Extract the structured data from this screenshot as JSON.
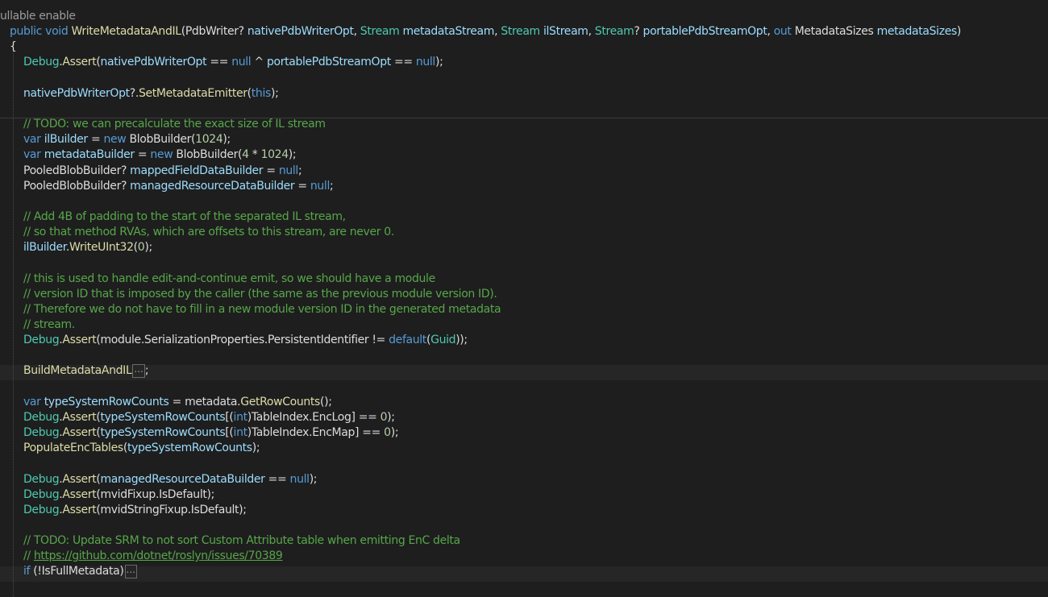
{
  "editor": {
    "lines": [
      {
        "indent": 0,
        "tokens": [
          {
            "t": "ullable enable",
            "c": "directive"
          }
        ]
      },
      {
        "indent": 1,
        "tokens": [
          {
            "t": "public",
            "c": "kw"
          },
          {
            "t": " ",
            "c": "pl"
          },
          {
            "t": "void",
            "c": "kw"
          },
          {
            "t": " ",
            "c": "pl"
          },
          {
            "t": "WriteMetadataAndIL",
            "c": "fn"
          },
          {
            "t": "(",
            "c": "pl"
          },
          {
            "t": "PdbWriter",
            "c": "pl"
          },
          {
            "t": "? ",
            "c": "pl"
          },
          {
            "t": "nativePdbWriterOpt",
            "c": "pm"
          },
          {
            "t": ", ",
            "c": "pl"
          },
          {
            "t": "Stream",
            "c": "tp"
          },
          {
            "t": " ",
            "c": "pl"
          },
          {
            "t": "metadataStream",
            "c": "pm"
          },
          {
            "t": ", ",
            "c": "pl"
          },
          {
            "t": "Stream",
            "c": "tp"
          },
          {
            "t": " ",
            "c": "pl"
          },
          {
            "t": "ilStream",
            "c": "pm"
          },
          {
            "t": ", ",
            "c": "pl"
          },
          {
            "t": "Stream",
            "c": "tp"
          },
          {
            "t": "? ",
            "c": "pl"
          },
          {
            "t": "portablePdbStreamOpt",
            "c": "pm"
          },
          {
            "t": ", ",
            "c": "pl"
          },
          {
            "t": "out",
            "c": "kw"
          },
          {
            "t": " ",
            "c": "pl"
          },
          {
            "t": "MetadataSizes",
            "c": "pl"
          },
          {
            "t": " ",
            "c": "pl"
          },
          {
            "t": "metadataSizes",
            "c": "pm"
          },
          {
            "t": ")",
            "c": "pl"
          }
        ]
      },
      {
        "indent": 1,
        "tokens": [
          {
            "t": "{",
            "c": "pl"
          }
        ]
      },
      {
        "indent": 2,
        "tokens": [
          {
            "t": "Debug",
            "c": "tp"
          },
          {
            "t": ".",
            "c": "pl"
          },
          {
            "t": "Assert",
            "c": "fn"
          },
          {
            "t": "(",
            "c": "pl"
          },
          {
            "t": "nativePdbWriterOpt",
            "c": "pm"
          },
          {
            "t": " == ",
            "c": "pl"
          },
          {
            "t": "null",
            "c": "kw"
          },
          {
            "t": " ^ ",
            "c": "pl"
          },
          {
            "t": "portablePdbStreamOpt",
            "c": "pm"
          },
          {
            "t": " == ",
            "c": "pl"
          },
          {
            "t": "null",
            "c": "kw"
          },
          {
            "t": ");",
            "c": "pl"
          }
        ]
      },
      {
        "indent": 2,
        "tokens": []
      },
      {
        "indent": 2,
        "tokens": [
          {
            "t": "nativePdbWriterOpt",
            "c": "pm"
          },
          {
            "t": "?.",
            "c": "pl"
          },
          {
            "t": "SetMetadataEmitter",
            "c": "fn"
          },
          {
            "t": "(",
            "c": "pl"
          },
          {
            "t": "this",
            "c": "kw"
          },
          {
            "t": ");",
            "c": "pl"
          }
        ]
      },
      {
        "indent": 2,
        "tokens": []
      },
      {
        "indent": 2,
        "tokens": [
          {
            "t": "// TODO: we can precalculate the exact size of IL stream",
            "c": "cm"
          }
        ]
      },
      {
        "indent": 2,
        "tokens": [
          {
            "t": "var",
            "c": "kw"
          },
          {
            "t": " ",
            "c": "pl"
          },
          {
            "t": "ilBuilder",
            "c": "lc"
          },
          {
            "t": " = ",
            "c": "pl"
          },
          {
            "t": "new",
            "c": "kw"
          },
          {
            "t": " ",
            "c": "pl"
          },
          {
            "t": "BlobBuilder",
            "c": "pl"
          },
          {
            "t": "(",
            "c": "pl"
          },
          {
            "t": "1024",
            "c": "nm"
          },
          {
            "t": ");",
            "c": "pl"
          }
        ]
      },
      {
        "indent": 2,
        "tokens": [
          {
            "t": "var",
            "c": "kw"
          },
          {
            "t": " ",
            "c": "pl"
          },
          {
            "t": "metadataBuilder",
            "c": "lc"
          },
          {
            "t": " = ",
            "c": "pl"
          },
          {
            "t": "new",
            "c": "kw"
          },
          {
            "t": " ",
            "c": "pl"
          },
          {
            "t": "BlobBuilder",
            "c": "pl"
          },
          {
            "t": "(",
            "c": "pl"
          },
          {
            "t": "4",
            "c": "nm"
          },
          {
            "t": " * ",
            "c": "pl"
          },
          {
            "t": "1024",
            "c": "nm"
          },
          {
            "t": ");",
            "c": "pl"
          }
        ]
      },
      {
        "indent": 2,
        "tokens": [
          {
            "t": "PooledBlobBuilder",
            "c": "pl"
          },
          {
            "t": "? ",
            "c": "pl"
          },
          {
            "t": "mappedFieldDataBuilder",
            "c": "lc"
          },
          {
            "t": " = ",
            "c": "pl"
          },
          {
            "t": "null",
            "c": "kw"
          },
          {
            "t": ";",
            "c": "pl"
          }
        ]
      },
      {
        "indent": 2,
        "tokens": [
          {
            "t": "PooledBlobBuilder",
            "c": "pl"
          },
          {
            "t": "? ",
            "c": "pl"
          },
          {
            "t": "managedResourceDataBuilder",
            "c": "lc"
          },
          {
            "t": " = ",
            "c": "pl"
          },
          {
            "t": "null",
            "c": "kw"
          },
          {
            "t": ";",
            "c": "pl"
          }
        ]
      },
      {
        "indent": 2,
        "tokens": []
      },
      {
        "indent": 2,
        "tokens": [
          {
            "t": "// Add 4B of padding to the start of the separated IL stream,",
            "c": "cm"
          }
        ]
      },
      {
        "indent": 2,
        "tokens": [
          {
            "t": "// so that method RVAs, which are offsets to this stream, are never 0.",
            "c": "cm"
          }
        ]
      },
      {
        "indent": 2,
        "tokens": [
          {
            "t": "ilBuilder",
            "c": "lc"
          },
          {
            "t": ".",
            "c": "pl"
          },
          {
            "t": "WriteUInt32",
            "c": "fn"
          },
          {
            "t": "(",
            "c": "pl"
          },
          {
            "t": "0",
            "c": "nm"
          },
          {
            "t": ");",
            "c": "pl"
          }
        ]
      },
      {
        "indent": 2,
        "tokens": []
      },
      {
        "indent": 2,
        "tokens": [
          {
            "t": "// this is used to handle edit-and-continue emit, so we should have a module",
            "c": "cm"
          }
        ]
      },
      {
        "indent": 2,
        "tokens": [
          {
            "t": "// version ID that is imposed by the caller (the same as the previous module version ID).",
            "c": "cm"
          }
        ]
      },
      {
        "indent": 2,
        "tokens": [
          {
            "t": "// Therefore we do not have to fill in a new module version ID in the generated metadata",
            "c": "cm"
          }
        ]
      },
      {
        "indent": 2,
        "tokens": [
          {
            "t": "// stream.",
            "c": "cm"
          }
        ]
      },
      {
        "indent": 2,
        "tokens": [
          {
            "t": "Debug",
            "c": "tp"
          },
          {
            "t": ".",
            "c": "pl"
          },
          {
            "t": "Assert",
            "c": "fn"
          },
          {
            "t": "(module.SerializationProperties.PersistentIdentifier != ",
            "c": "pl"
          },
          {
            "t": "default",
            "c": "kw"
          },
          {
            "t": "(",
            "c": "pl"
          },
          {
            "t": "Guid",
            "c": "tp"
          },
          {
            "t": "));",
            "c": "pl"
          }
        ]
      },
      {
        "indent": 2,
        "tokens": []
      },
      {
        "indent": 2,
        "collapsed": true,
        "tokens": [
          {
            "t": "BuildMetadataAndIL",
            "c": "fn"
          }
        ],
        "after": ";"
      },
      {
        "indent": 2,
        "tokens": []
      },
      {
        "indent": 2,
        "tokens": [
          {
            "t": "var",
            "c": "kw"
          },
          {
            "t": " ",
            "c": "pl"
          },
          {
            "t": "typeSystemRowCounts",
            "c": "lc"
          },
          {
            "t": " = metadata.",
            "c": "pl"
          },
          {
            "t": "GetRowCounts",
            "c": "fn"
          },
          {
            "t": "();",
            "c": "pl"
          }
        ]
      },
      {
        "indent": 2,
        "tokens": [
          {
            "t": "Debug",
            "c": "tp"
          },
          {
            "t": ".",
            "c": "pl"
          },
          {
            "t": "Assert",
            "c": "fn"
          },
          {
            "t": "(",
            "c": "pl"
          },
          {
            "t": "typeSystemRowCounts",
            "c": "lc"
          },
          {
            "t": "[(",
            "c": "pl"
          },
          {
            "t": "int",
            "c": "kw"
          },
          {
            "t": ")TableIndex.EncLog] == ",
            "c": "pl"
          },
          {
            "t": "0",
            "c": "nm"
          },
          {
            "t": ");",
            "c": "pl"
          }
        ]
      },
      {
        "indent": 2,
        "tokens": [
          {
            "t": "Debug",
            "c": "tp"
          },
          {
            "t": ".",
            "c": "pl"
          },
          {
            "t": "Assert",
            "c": "fn"
          },
          {
            "t": "(",
            "c": "pl"
          },
          {
            "t": "typeSystemRowCounts",
            "c": "lc"
          },
          {
            "t": "[(",
            "c": "pl"
          },
          {
            "t": "int",
            "c": "kw"
          },
          {
            "t": ")TableIndex.EncMap] == ",
            "c": "pl"
          },
          {
            "t": "0",
            "c": "nm"
          },
          {
            "t": ");",
            "c": "pl"
          }
        ]
      },
      {
        "indent": 2,
        "tokens": [
          {
            "t": "PopulateEncTables",
            "c": "fn"
          },
          {
            "t": "(",
            "c": "pl"
          },
          {
            "t": "typeSystemRowCounts",
            "c": "lc"
          },
          {
            "t": ");",
            "c": "pl"
          }
        ]
      },
      {
        "indent": 2,
        "tokens": []
      },
      {
        "indent": 2,
        "tokens": [
          {
            "t": "Debug",
            "c": "tp"
          },
          {
            "t": ".",
            "c": "pl"
          },
          {
            "t": "Assert",
            "c": "fn"
          },
          {
            "t": "(",
            "c": "pl"
          },
          {
            "t": "managedResourceDataBuilder",
            "c": "lc"
          },
          {
            "t": " == ",
            "c": "pl"
          },
          {
            "t": "null",
            "c": "kw"
          },
          {
            "t": ");",
            "c": "pl"
          }
        ]
      },
      {
        "indent": 2,
        "tokens": [
          {
            "t": "Debug",
            "c": "tp"
          },
          {
            "t": ".",
            "c": "pl"
          },
          {
            "t": "Assert",
            "c": "fn"
          },
          {
            "t": "(mvidFixup.IsDefault);",
            "c": "pl"
          }
        ]
      },
      {
        "indent": 2,
        "tokens": [
          {
            "t": "Debug",
            "c": "tp"
          },
          {
            "t": ".",
            "c": "pl"
          },
          {
            "t": "Assert",
            "c": "fn"
          },
          {
            "t": "(mvidStringFixup.IsDefault);",
            "c": "pl"
          }
        ]
      },
      {
        "indent": 2,
        "tokens": []
      },
      {
        "indent": 2,
        "tokens": [
          {
            "t": "// TODO: Update SRM to not sort Custom Attribute table when emitting EnC delta",
            "c": "cm"
          }
        ]
      },
      {
        "indent": 2,
        "tokens": [
          {
            "t": "// ",
            "c": "cm"
          },
          {
            "t": "https://github.com/dotnet/roslyn/issues/70389",
            "c": "link"
          }
        ]
      },
      {
        "indent": 2,
        "collapsed": true,
        "tokens": [
          {
            "t": "if",
            "c": "kw"
          },
          {
            "t": " (!",
            "c": "pl"
          },
          {
            "t": "IsFullMetadata",
            "c": "pl"
          },
          {
            "t": ")",
            "c": "pl"
          }
        ],
        "after": ""
      }
    ],
    "collapsed_marker": "..."
  }
}
